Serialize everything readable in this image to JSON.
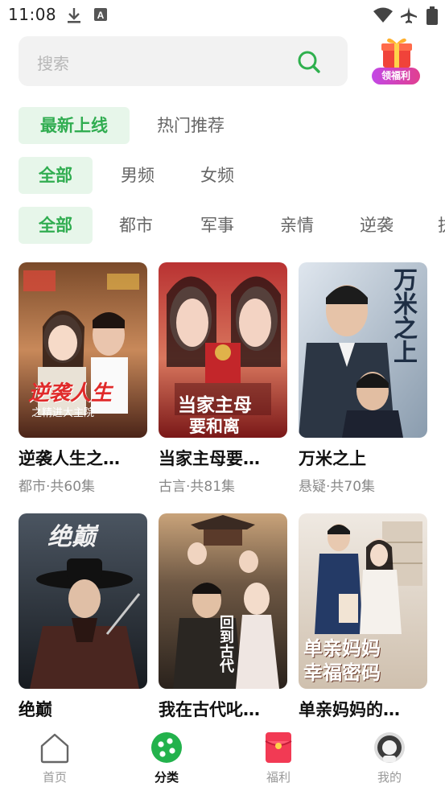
{
  "status_bar": {
    "time": "11:08"
  },
  "search": {
    "placeholder": "搜索"
  },
  "gift": {
    "label": "领福利"
  },
  "sort_tabs": [
    {
      "label": "最新上线",
      "active": true
    },
    {
      "label": "热门推荐",
      "active": false
    }
  ],
  "gender_tabs": [
    {
      "label": "全部",
      "active": true
    },
    {
      "label": "男频",
      "active": false
    },
    {
      "label": "女频",
      "active": false
    }
  ],
  "genre_tabs": [
    {
      "label": "全部",
      "active": true
    },
    {
      "label": "都市",
      "active": false
    },
    {
      "label": "军事",
      "active": false
    },
    {
      "label": "亲情",
      "active": false
    },
    {
      "label": "逆袭",
      "active": false
    },
    {
      "label": "执",
      "active": false
    }
  ],
  "dramas": [
    {
      "title": "逆袭人生之…",
      "meta": "都市·共60集",
      "poster_text": "逆袭人生",
      "poster_sub": "之精进大主院",
      "theme": "#8a3a2a"
    },
    {
      "title": "当家主母要…",
      "meta": "古言·共81集",
      "poster_text": "当家主母",
      "poster_sub": "要和离",
      "theme": "#b42a2a"
    },
    {
      "title": "万米之上",
      "meta": "悬疑·共70集",
      "poster_text": "万米之上",
      "poster_sub": "",
      "theme": "#5d7184"
    },
    {
      "title": "绝巅",
      "meta": "",
      "poster_text": "绝巅",
      "poster_sub": "",
      "theme": "#2f3640"
    },
    {
      "title": "我在古代叱…",
      "meta": "",
      "poster_text": "回到古代",
      "poster_sub": "",
      "theme": "#5a4a3a"
    },
    {
      "title": "单亲妈妈的…",
      "meta": "",
      "poster_text": "单亲妈妈",
      "poster_sub": "幸福密码",
      "theme": "#c9b9a5"
    }
  ],
  "bottom_nav": [
    {
      "label": "首页",
      "icon": "home-icon",
      "active": false
    },
    {
      "label": "分类",
      "icon": "category-icon",
      "active": true
    },
    {
      "label": "福利",
      "icon": "red-envelope-icon",
      "active": false
    },
    {
      "label": "我的",
      "icon": "profile-icon",
      "active": false
    }
  ],
  "colors": {
    "accent": "#31ad51",
    "accent_bg": "#e7f6ea"
  }
}
